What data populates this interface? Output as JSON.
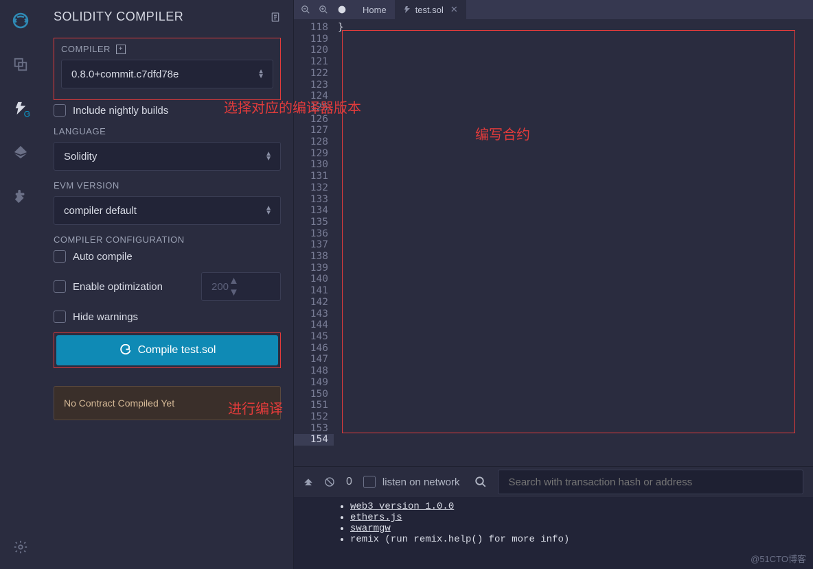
{
  "panel": {
    "title": "SOLIDITY COMPILER",
    "compiler_label": "COMPILER",
    "compiler_value": "0.8.0+commit.c7dfd78e",
    "include_nightly": "Include nightly builds",
    "language_label": "LANGUAGE",
    "language_value": "Solidity",
    "evm_label": "EVM VERSION",
    "evm_value": "compiler default",
    "config_label": "COMPILER CONFIGURATION",
    "auto_compile": "Auto compile",
    "enable_opt": "Enable optimization",
    "runs_value": "200",
    "hide_warnings": "Hide warnings",
    "compile_btn": "Compile test.sol",
    "no_contract": "No Contract Compiled Yet"
  },
  "tabs": {
    "home": "Home",
    "file": "test.sol"
  },
  "editor": {
    "first_line": 118,
    "last_line": 154,
    "brace_line": 118,
    "highlight_line": 154
  },
  "terminal": {
    "count": "0",
    "listen_label": "listen on network",
    "search_placeholder": "Search with transaction hash or address",
    "lines": [
      "web3 version 1.0.0",
      "ethers.js",
      "swarmgw"
    ],
    "plain_line": "remix (run remix.help() for more info)"
  },
  "annotations": {
    "compiler_note": "选择对应的编译器版本",
    "editor_note": "编写合约",
    "compile_note": "进行编译"
  },
  "watermark": "@51CTO博客"
}
